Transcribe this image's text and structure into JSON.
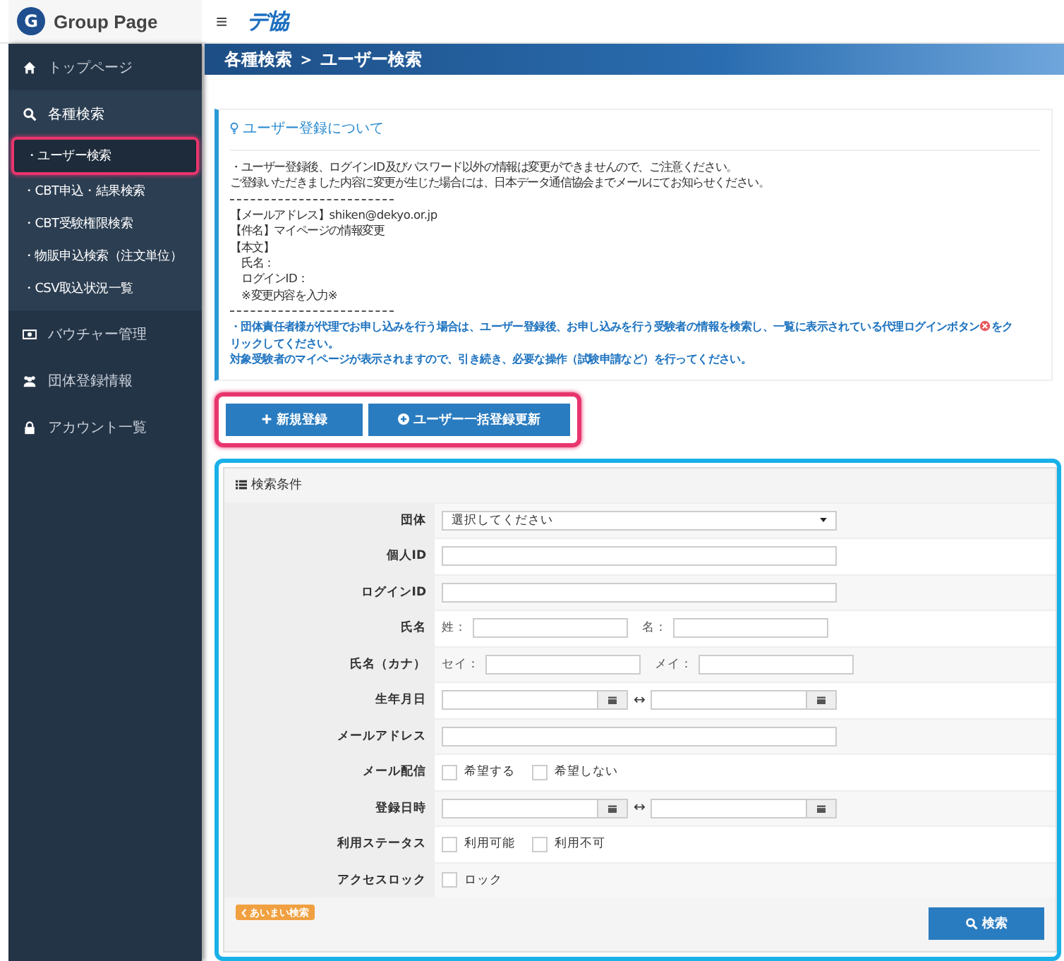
{
  "header": {
    "brand": "Group Page",
    "brand_initial": "G",
    "menu_glyph": "≡",
    "logo": "デ協"
  },
  "sidebar": {
    "items": [
      {
        "label": "トップページ",
        "kind": "home",
        "selected": false
      },
      {
        "label": "各種検索",
        "kind": "search",
        "selected": false,
        "children": [
          {
            "label": "・ユーザー検索",
            "selected": true
          },
          {
            "label": "・CBT申込・結果検索",
            "selected": false
          },
          {
            "label": "・CBT受験権限検索",
            "selected": false
          },
          {
            "label": "・物販申込検索（注文単位）",
            "selected": false
          },
          {
            "label": "・CSV取込状況一覧",
            "selected": false
          }
        ]
      },
      {
        "label": "バウチャー管理",
        "kind": "money",
        "selected": false
      },
      {
        "label": "団体登録情報",
        "kind": "users",
        "selected": false
      },
      {
        "label": "アカウント一覧",
        "kind": "lock",
        "selected": false
      }
    ]
  },
  "breadcrumb": {
    "parent": "各種検索",
    "sep": "＞",
    "current": "ユーザー検索"
  },
  "info": {
    "title": "ユーザー登録について",
    "lines": [
      {
        "kind": "text",
        "text": "・ユーザー登録後、ログインID及びパスワード以外の情報は変更ができませんので、ご注意ください。"
      },
      {
        "kind": "text",
        "text": "ご登録いただきました内容に変更が生じた場合には、日本データ通信協会までメールにてお知らせください。"
      },
      {
        "kind": "rule"
      },
      {
        "kind": "text",
        "text": "【メールアドレス】shiken@dekyo.or.jp"
      },
      {
        "kind": "text",
        "text": "【件名】マイページの情報変更"
      },
      {
        "kind": "text",
        "text": "【本文】"
      },
      {
        "kind": "indent",
        "text": "氏名："
      },
      {
        "kind": "indent",
        "text": "ログインID："
      },
      {
        "kind": "indent",
        "text": "※変更内容を入力※"
      },
      {
        "kind": "rule"
      },
      {
        "kind": "note",
        "text": "・団体責任者様が代理でお申し込みを行う場合は、ユーザー登録後、お申し込みを行う受験者の情報を検索し、一覧に表示されている代理ログインボタン",
        "text_after": "をク"
      },
      {
        "kind": "note",
        "text": "リックしてください。"
      },
      {
        "kind": "note",
        "text": "対象受験者のマイページが表示されますので、引き続き、必要な操作（試験申請など）を行ってください。"
      }
    ]
  },
  "actions": [
    {
      "label": "新規登録",
      "kind": "plus"
    },
    {
      "label": "ユーザー一括登録更新",
      "kind": "plus-circle"
    }
  ],
  "search": {
    "title": "検索条件",
    "rows": [
      {
        "label": "団体",
        "kind": "select",
        "value": "選択してください"
      },
      {
        "label": "個人ID",
        "kind": "text"
      },
      {
        "label": "ログインID",
        "kind": "text"
      },
      {
        "label": "氏名",
        "kind": "pair",
        "parts": [
          "姓：",
          "名："
        ]
      },
      {
        "label": "氏名（カナ）",
        "kind": "pair",
        "parts": [
          "セイ：",
          "メイ："
        ]
      },
      {
        "label": "生年月日",
        "kind": "daterange",
        "sep": "↔"
      },
      {
        "label": "メールアドレス",
        "kind": "text"
      },
      {
        "label": "メール配信",
        "kind": "checks",
        "options": [
          {
            "label": "希望する",
            "checked": false
          },
          {
            "label": "希望しない",
            "checked": false
          }
        ]
      },
      {
        "label": "登録日時",
        "kind": "daterange",
        "sep": "↔"
      },
      {
        "label": "利用ステータス",
        "kind": "checks",
        "options": [
          {
            "label": "利用可能",
            "checked": false
          },
          {
            "label": "利用不可",
            "checked": false
          }
        ]
      },
      {
        "label": "アクセスロック",
        "kind": "checks",
        "options": [
          {
            "label": "ロック",
            "checked": false
          }
        ]
      }
    ],
    "fuzzy": "あいまい検索",
    "submit": "検索"
  }
}
